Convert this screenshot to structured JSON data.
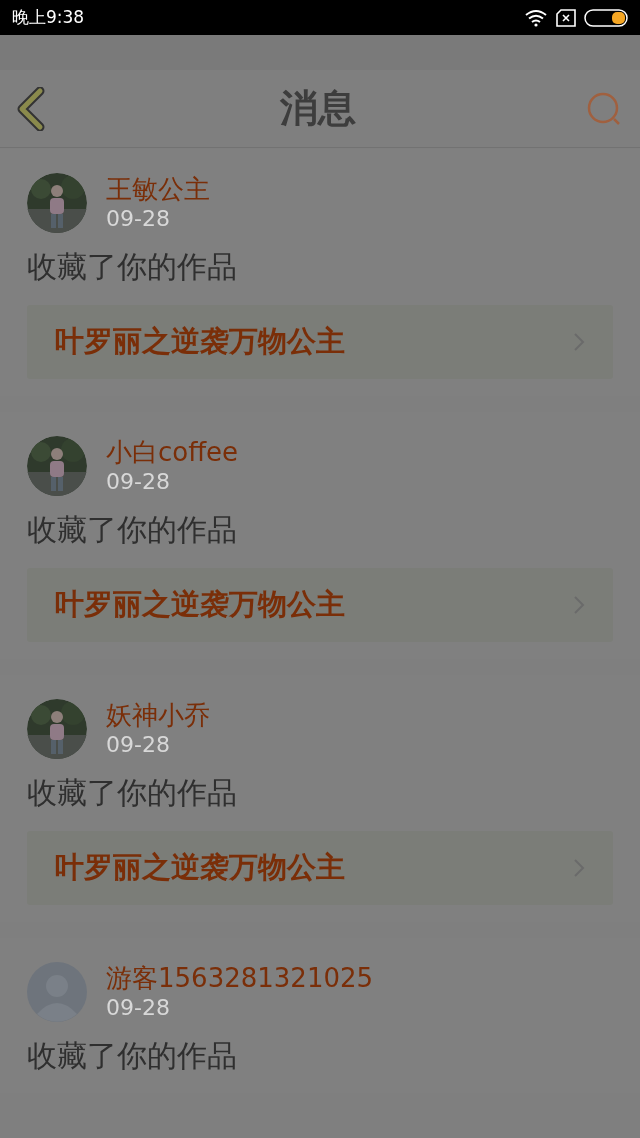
{
  "status_bar": {
    "time": "晚上9:38"
  },
  "header": {
    "title": "消息"
  },
  "messages": [
    {
      "user": "王敏公主",
      "date": "09-28",
      "action": "收藏了你的作品",
      "work": "叶罗丽之逆袭万物公主"
    },
    {
      "user": "小白coffee",
      "date": "09-28",
      "action": "收藏了你的作品",
      "work": "叶罗丽之逆袭万物公主"
    },
    {
      "user": "妖神小乔",
      "date": "09-28",
      "action": "收藏了你的作品",
      "work": "叶罗丽之逆袭万物公主"
    },
    {
      "user": "游客1563281321025",
      "date": "09-28",
      "avatar": {
        "kind": "default"
      },
      "action": "收藏了你的作品"
    }
  ]
}
